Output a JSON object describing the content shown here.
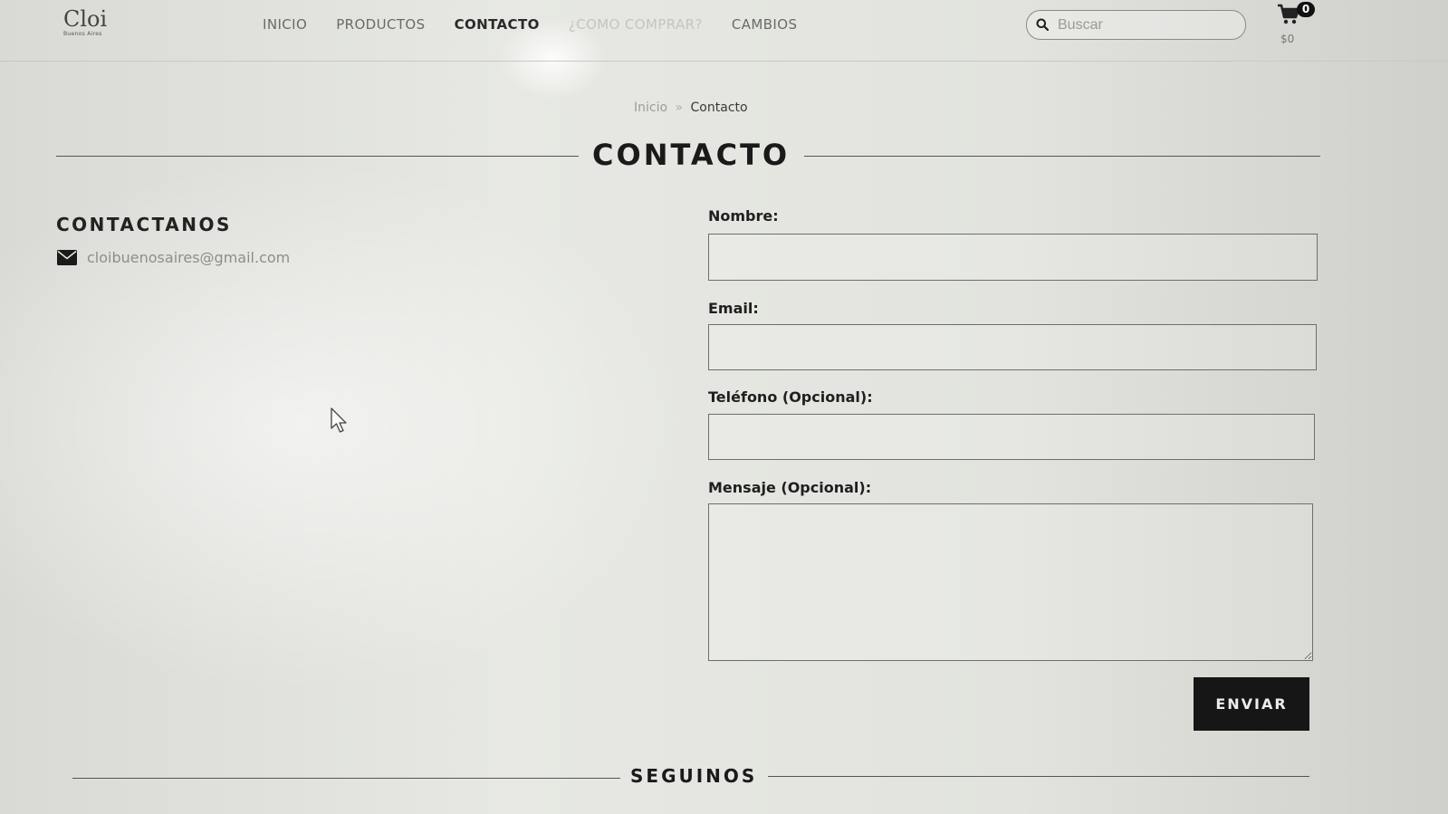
{
  "header": {
    "logo": {
      "main": "Cloi",
      "sub": "Buenos Aires"
    },
    "nav": [
      {
        "label": "INICIO"
      },
      {
        "label": "PRODUCTOS"
      },
      {
        "label": "CONTACTO",
        "active": true
      },
      {
        "label": "¿COMO COMPRAR?"
      },
      {
        "label": "CAMBIOS"
      }
    ],
    "search": {
      "placeholder": "Buscar"
    },
    "cart": {
      "count": "0",
      "total": "$0"
    }
  },
  "breadcrumb": {
    "home": "Inicio",
    "separator": "»",
    "current": "Contacto"
  },
  "page": {
    "title": "CONTACTO"
  },
  "contact_info": {
    "heading": "CONTACTANOS",
    "email": "cloibuenosaires@gmail.com"
  },
  "form": {
    "name_label": "Nombre:",
    "email_label": "Email:",
    "phone_label": "Teléfono (Opcional):",
    "message_label": "Mensaje (Opcional):",
    "name_value": "",
    "email_value": "",
    "phone_value": "",
    "message_value": "",
    "submit_label": "ENVIAR"
  },
  "footer": {
    "follow_heading": "SEGUINOS"
  },
  "colors": {
    "button_bg": "#161616",
    "badge_bg": "#111111",
    "text_dark": "#1d1d1d"
  },
  "icons": [
    "search-icon",
    "cart-icon",
    "mail-icon",
    "mouse-cursor-icon"
  ]
}
